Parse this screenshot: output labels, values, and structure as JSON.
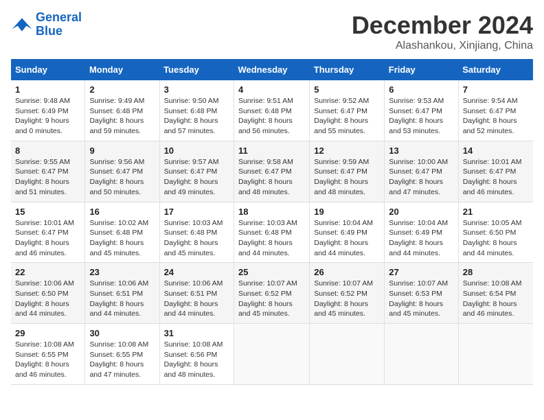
{
  "header": {
    "logo_line1": "General",
    "logo_line2": "Blue",
    "month_year": "December 2024",
    "location": "Alashankou, Xinjiang, China"
  },
  "columns": [
    "Sunday",
    "Monday",
    "Tuesday",
    "Wednesday",
    "Thursday",
    "Friday",
    "Saturday"
  ],
  "weeks": [
    [
      {
        "day": "1",
        "sunrise": "9:48 AM",
        "sunset": "6:49 PM",
        "daylight": "9 hours and 0 minutes."
      },
      {
        "day": "2",
        "sunrise": "9:49 AM",
        "sunset": "6:48 PM",
        "daylight": "8 hours and 59 minutes."
      },
      {
        "day": "3",
        "sunrise": "9:50 AM",
        "sunset": "6:48 PM",
        "daylight": "8 hours and 57 minutes."
      },
      {
        "day": "4",
        "sunrise": "9:51 AM",
        "sunset": "6:48 PM",
        "daylight": "8 hours and 56 minutes."
      },
      {
        "day": "5",
        "sunrise": "9:52 AM",
        "sunset": "6:47 PM",
        "daylight": "8 hours and 55 minutes."
      },
      {
        "day": "6",
        "sunrise": "9:53 AM",
        "sunset": "6:47 PM",
        "daylight": "8 hours and 53 minutes."
      },
      {
        "day": "7",
        "sunrise": "9:54 AM",
        "sunset": "6:47 PM",
        "daylight": "8 hours and 52 minutes."
      }
    ],
    [
      {
        "day": "8",
        "sunrise": "9:55 AM",
        "sunset": "6:47 PM",
        "daylight": "8 hours and 51 minutes."
      },
      {
        "day": "9",
        "sunrise": "9:56 AM",
        "sunset": "6:47 PM",
        "daylight": "8 hours and 50 minutes."
      },
      {
        "day": "10",
        "sunrise": "9:57 AM",
        "sunset": "6:47 PM",
        "daylight": "8 hours and 49 minutes."
      },
      {
        "day": "11",
        "sunrise": "9:58 AM",
        "sunset": "6:47 PM",
        "daylight": "8 hours and 48 minutes."
      },
      {
        "day": "12",
        "sunrise": "9:59 AM",
        "sunset": "6:47 PM",
        "daylight": "8 hours and 48 minutes."
      },
      {
        "day": "13",
        "sunrise": "10:00 AM",
        "sunset": "6:47 PM",
        "daylight": "8 hours and 47 minutes."
      },
      {
        "day": "14",
        "sunrise": "10:01 AM",
        "sunset": "6:47 PM",
        "daylight": "8 hours and 46 minutes."
      }
    ],
    [
      {
        "day": "15",
        "sunrise": "10:01 AM",
        "sunset": "6:47 PM",
        "daylight": "8 hours and 46 minutes."
      },
      {
        "day": "16",
        "sunrise": "10:02 AM",
        "sunset": "6:48 PM",
        "daylight": "8 hours and 45 minutes."
      },
      {
        "day": "17",
        "sunrise": "10:03 AM",
        "sunset": "6:48 PM",
        "daylight": "8 hours and 45 minutes."
      },
      {
        "day": "18",
        "sunrise": "10:03 AM",
        "sunset": "6:48 PM",
        "daylight": "8 hours and 44 minutes."
      },
      {
        "day": "19",
        "sunrise": "10:04 AM",
        "sunset": "6:49 PM",
        "daylight": "8 hours and 44 minutes."
      },
      {
        "day": "20",
        "sunrise": "10:04 AM",
        "sunset": "6:49 PM",
        "daylight": "8 hours and 44 minutes."
      },
      {
        "day": "21",
        "sunrise": "10:05 AM",
        "sunset": "6:50 PM",
        "daylight": "8 hours and 44 minutes."
      }
    ],
    [
      {
        "day": "22",
        "sunrise": "10:06 AM",
        "sunset": "6:50 PM",
        "daylight": "8 hours and 44 minutes."
      },
      {
        "day": "23",
        "sunrise": "10:06 AM",
        "sunset": "6:51 PM",
        "daylight": "8 hours and 44 minutes."
      },
      {
        "day": "24",
        "sunrise": "10:06 AM",
        "sunset": "6:51 PM",
        "daylight": "8 hours and 44 minutes."
      },
      {
        "day": "25",
        "sunrise": "10:07 AM",
        "sunset": "6:52 PM",
        "daylight": "8 hours and 45 minutes."
      },
      {
        "day": "26",
        "sunrise": "10:07 AM",
        "sunset": "6:52 PM",
        "daylight": "8 hours and 45 minutes."
      },
      {
        "day": "27",
        "sunrise": "10:07 AM",
        "sunset": "6:53 PM",
        "daylight": "8 hours and 45 minutes."
      },
      {
        "day": "28",
        "sunrise": "10:08 AM",
        "sunset": "6:54 PM",
        "daylight": "8 hours and 46 minutes."
      }
    ],
    [
      {
        "day": "29",
        "sunrise": "10:08 AM",
        "sunset": "6:55 PM",
        "daylight": "8 hours and 46 minutes."
      },
      {
        "day": "30",
        "sunrise": "10:08 AM",
        "sunset": "6:55 PM",
        "daylight": "8 hours and 47 minutes."
      },
      {
        "day": "31",
        "sunrise": "10:08 AM",
        "sunset": "6:56 PM",
        "daylight": "8 hours and 48 minutes."
      },
      null,
      null,
      null,
      null
    ]
  ]
}
